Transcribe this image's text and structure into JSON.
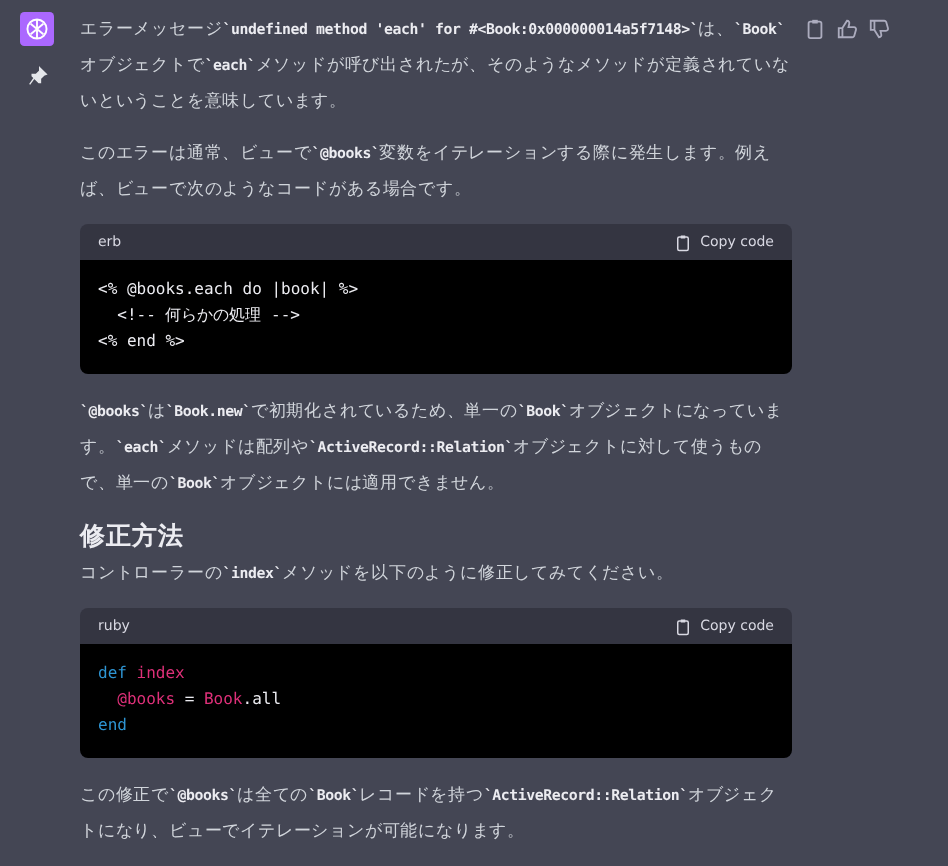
{
  "message": {
    "blocks": [
      {
        "kind": "paragraph",
        "text": "エラーメッセージ**`undefined method 'each' for #<Book:0x000000014a5f7148>`**は、**`Book`**オブジェクトで**`each`**メソッドが呼び出されたが、そのようなメソッドが定義されていないということを意味しています。"
      },
      {
        "kind": "paragraph",
        "text": "このエラーは通常、ビューで**`@books`**変数をイテレーションする際に発生します。例えば、ビューで次のようなコードがある場合です。"
      },
      {
        "kind": "code",
        "language": "erb",
        "copy_label": "Copy code",
        "lines": [
          [
            {
              "text": "<% @books.each do |book| %>",
              "kind": "plain"
            }
          ],
          [
            {
              "text": "  <!-- 何らかの処理 -->",
              "kind": "plain"
            }
          ],
          [
            {
              "text": "<% end %>",
              "kind": "plain"
            }
          ]
        ]
      },
      {
        "kind": "paragraph",
        "text": "**`@books`**は**`Book.new`**で初期化されているため、単一の**`Book`**オブジェクトになっています。**`each`**メソッドは配列や**`ActiveRecord::Relation`**オブジェクトに対して使うもので、単一の**`Book`**オブジェクトには適用できません。"
      },
      {
        "kind": "heading",
        "text": "修正方法"
      },
      {
        "kind": "paragraph",
        "text": "コントローラーの**`index`**メソッドを以下のように修正してみてください。"
      },
      {
        "kind": "code",
        "language": "ruby",
        "copy_label": "Copy code",
        "lines": [
          [
            {
              "text": "def",
              "kind": "keyword"
            },
            {
              "text": " index",
              "kind": "name"
            }
          ],
          [
            {
              "text": "  @books",
              "kind": "name"
            },
            {
              "text": " = ",
              "kind": "plain"
            },
            {
              "text": "Book",
              "kind": "name"
            },
            {
              "text": ".all",
              "kind": "plain"
            }
          ],
          [
            {
              "text": "end",
              "kind": "keyword"
            }
          ]
        ]
      },
      {
        "kind": "paragraph",
        "text": "この修正で**`@books`**は全ての**`Book`**レコードを持つ**`ActiveRecord::Relation`**オブジェクトになり、ビューでイテレーションが可能になります。"
      }
    ]
  }
}
